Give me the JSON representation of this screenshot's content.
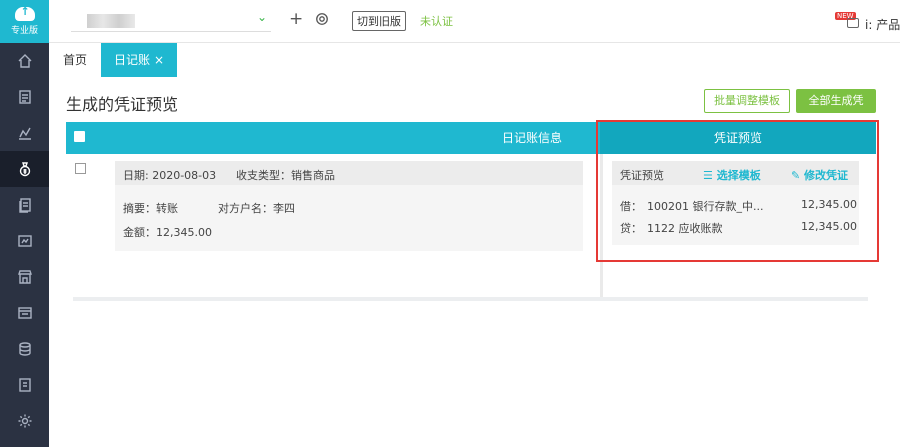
{
  "sidebar": {
    "logo_text": "专业版",
    "items": [
      {
        "icon": "home-icon"
      },
      {
        "icon": "voucher-icon"
      },
      {
        "icon": "chart-icon"
      },
      {
        "icon": "money-bag-icon",
        "active": true
      },
      {
        "icon": "document-icon"
      },
      {
        "icon": "report-icon"
      },
      {
        "icon": "store-icon"
      },
      {
        "icon": "invoice-icon"
      },
      {
        "icon": "coins-icon"
      },
      {
        "icon": "archive-icon"
      },
      {
        "icon": "settings-icon"
      }
    ]
  },
  "topbar": {
    "switch_label": "切到旧版",
    "unverified_label": "未认证",
    "new_badge": "NEW",
    "product_label": "i: 产品"
  },
  "tabs": {
    "home": "首页",
    "journal": "日记账",
    "close": "×"
  },
  "page": {
    "title": "生成的凭证预览",
    "batch_button": "批量调整模板",
    "all_button": "全部生成凭"
  },
  "table": {
    "left_header": "日记账信息",
    "right_header": "凭证预览"
  },
  "journal_entry": {
    "date": "日期: 2020-08-03",
    "type": "收支类型：销售商品",
    "summary": "摘要：转账",
    "counterparty": "对方户名：李四",
    "amount": "金额：12,345.00"
  },
  "voucher_preview": {
    "title": "凭证预览",
    "select_template": "选择模板",
    "edit_voucher": "修改凭证",
    "debit": {
      "label": "借：",
      "account": "100201 银行存款_中...",
      "amount": "12,345.00"
    },
    "credit": {
      "label": "贷：",
      "account": "1122 应收账款",
      "amount": "12,345.00"
    }
  },
  "colors": {
    "accent": "#1fb8d0",
    "green": "#7cc142",
    "sidebar": "#2b3242",
    "highlight": "#e53935"
  }
}
